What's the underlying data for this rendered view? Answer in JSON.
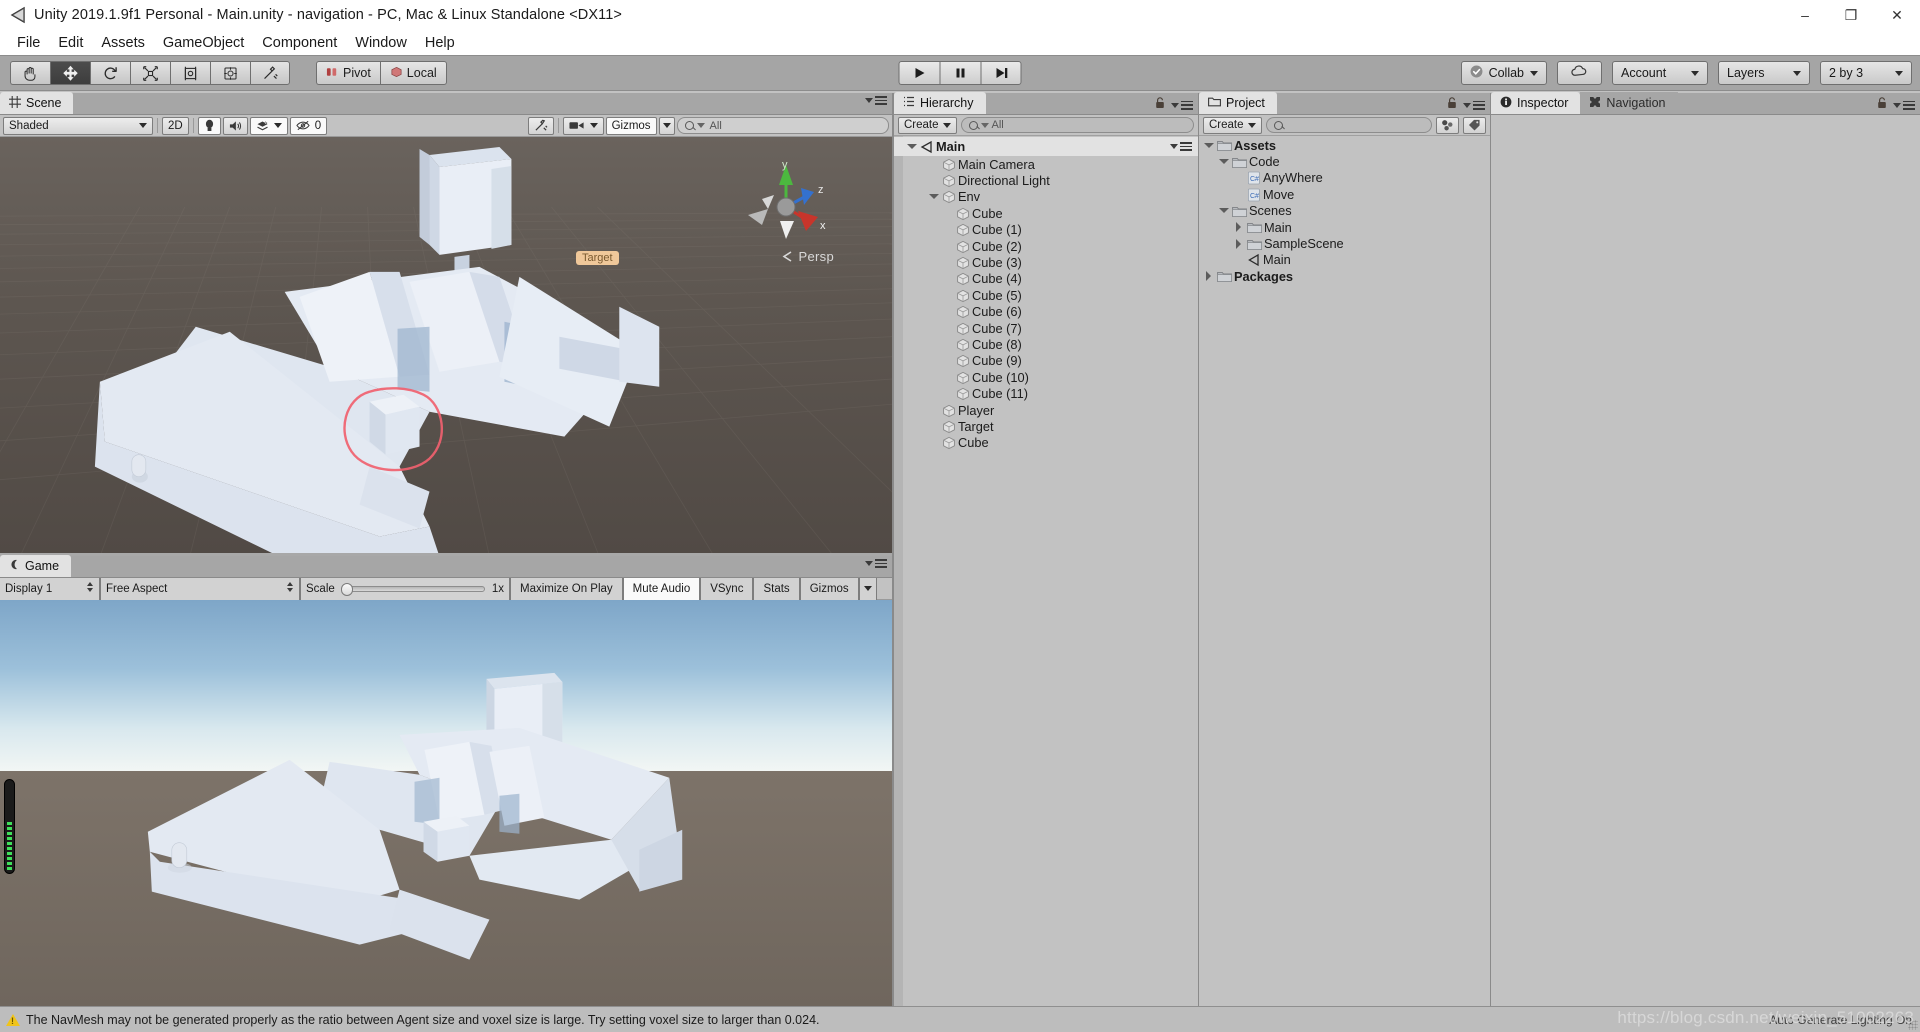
{
  "window": {
    "title": "Unity 2019.1.9f1 Personal - Main.unity - navigation - PC, Mac & Linux Standalone <DX11>",
    "minimize": "–",
    "maximize": "❐",
    "close": "✕"
  },
  "menubar": {
    "items": [
      "File",
      "Edit",
      "Assets",
      "GameObject",
      "Component",
      "Window",
      "Help"
    ]
  },
  "toolbar": {
    "tools": [
      "hand-tool",
      "move-tool",
      "rotate-tool",
      "scale-tool",
      "rect-tool",
      "transform-tool",
      "custom-tool"
    ],
    "active_tool": "move-tool",
    "pivot_label": "Pivot",
    "local_label": "Local",
    "play_label": "play",
    "pause_label": "pause",
    "step_label": "step",
    "collab_label": "Collab",
    "cloud_label": "cloud",
    "account_label": "Account",
    "layers_label": "Layers",
    "layout_label": "2 by 3"
  },
  "scene": {
    "tab_label": "Scene",
    "shading_mode": "Shaded",
    "mode_2d": "2D",
    "lighting_toggle": "light-icon",
    "audio_toggle": "audio-icon",
    "fx_label": "effects-icon",
    "hidden_count": "0",
    "tools_icon": "scene-tools-icon",
    "camera_icon": "scene-camera-icon",
    "gizmos_label": "Gizmos",
    "search_placeholder": "All",
    "persp_label": "Persp",
    "axis_x": "x",
    "axis_y": "y",
    "axis_z": "z",
    "target_label": "Target"
  },
  "game": {
    "tab_label": "Game",
    "display": "Display 1",
    "aspect": "Free Aspect",
    "scale_label": "Scale",
    "scale_value": "1x",
    "maximize_on_play": "Maximize On Play",
    "mute_audio": "Mute Audio",
    "vsync": "VSync",
    "stats": "Stats",
    "gizmos": "Gizmos"
  },
  "hierarchy": {
    "tab_label": "Hierarchy",
    "create_label": "Create",
    "search_placeholder": "All",
    "scene_name": "Main",
    "items": [
      {
        "label": "Main Camera",
        "depth": 2,
        "twisty": "none"
      },
      {
        "label": "Directional Light",
        "depth": 2,
        "twisty": "none"
      },
      {
        "label": "Env",
        "depth": 2,
        "twisty": "open"
      },
      {
        "label": "Cube",
        "depth": 3,
        "twisty": "none"
      },
      {
        "label": "Cube (1)",
        "depth": 3,
        "twisty": "none"
      },
      {
        "label": "Cube (2)",
        "depth": 3,
        "twisty": "none"
      },
      {
        "label": "Cube (3)",
        "depth": 3,
        "twisty": "none"
      },
      {
        "label": "Cube (4)",
        "depth": 3,
        "twisty": "none"
      },
      {
        "label": "Cube (5)",
        "depth": 3,
        "twisty": "none"
      },
      {
        "label": "Cube (6)",
        "depth": 3,
        "twisty": "none"
      },
      {
        "label": "Cube (7)",
        "depth": 3,
        "twisty": "none"
      },
      {
        "label": "Cube (8)",
        "depth": 3,
        "twisty": "none"
      },
      {
        "label": "Cube (9)",
        "depth": 3,
        "twisty": "none"
      },
      {
        "label": "Cube (10)",
        "depth": 3,
        "twisty": "none"
      },
      {
        "label": "Cube (11)",
        "depth": 3,
        "twisty": "none"
      },
      {
        "label": "Player",
        "depth": 2,
        "twisty": "none"
      },
      {
        "label": "Target",
        "depth": 2,
        "twisty": "none"
      },
      {
        "label": "Cube",
        "depth": 2,
        "twisty": "none"
      }
    ]
  },
  "project": {
    "tab_label": "Project",
    "create_label": "Create",
    "search_placeholder": "",
    "items": [
      {
        "label": "Assets",
        "depth": 0,
        "twisty": "open",
        "icon": "folder",
        "bold": true
      },
      {
        "label": "Code",
        "depth": 1,
        "twisty": "open",
        "icon": "folder",
        "bold": false
      },
      {
        "label": "AnyWhere",
        "depth": 2,
        "twisty": "none",
        "icon": "csharp",
        "bold": false
      },
      {
        "label": "Move",
        "depth": 2,
        "twisty": "none",
        "icon": "csharp",
        "bold": false
      },
      {
        "label": "Scenes",
        "depth": 1,
        "twisty": "open",
        "icon": "folder",
        "bold": false
      },
      {
        "label": "Main",
        "depth": 2,
        "twisty": "closed",
        "icon": "folder",
        "bold": false
      },
      {
        "label": "SampleScene",
        "depth": 2,
        "twisty": "closed",
        "icon": "folder",
        "bold": false
      },
      {
        "label": "Main",
        "depth": 2,
        "twisty": "none",
        "icon": "unity",
        "bold": false
      },
      {
        "label": "Packages",
        "depth": 0,
        "twisty": "closed",
        "icon": "folder",
        "bold": true
      }
    ]
  },
  "inspector": {
    "tab_label": "Inspector",
    "nav_tab_label": "Navigation"
  },
  "status": {
    "message": "The NavMesh may not be generated properly as the ratio between Agent size and voxel size is large. Try setting voxel size to larger than 0.024.",
    "right_text": "Auto Generate Lighting On",
    "watermark": "https://blog.csdn.net/weixin_51002263"
  },
  "colors": {
    "toolbar_bg": "#a5a5a5",
    "panel_bg": "#c2c2c2",
    "tab_active": "#e2e2e2",
    "scene_bg": "#5c5550",
    "selection_outline": "#f06a7a",
    "axis_x": "#c8372d",
    "axis_y": "#46b93c",
    "axis_z": "#2f6fd0",
    "warn": "#f0c419"
  }
}
